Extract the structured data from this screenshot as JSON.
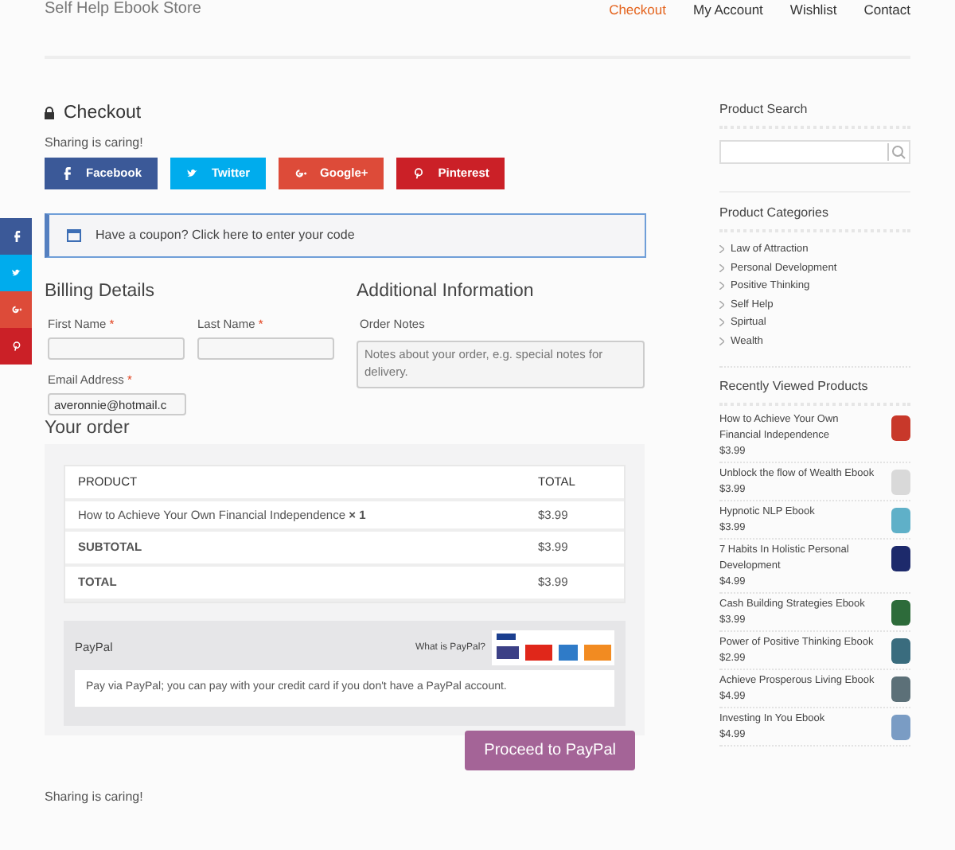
{
  "header": {
    "site_title": "Self Help Ebook Store",
    "nav": [
      {
        "label": "Checkout",
        "selected": true
      },
      {
        "label": "My Account",
        "selected": false
      },
      {
        "label": "Wishlist",
        "selected": false
      },
      {
        "label": "Contact",
        "selected": false
      }
    ]
  },
  "side_share": [
    {
      "kind": "facebook",
      "color": "#3b5998"
    },
    {
      "kind": "twitter",
      "color": "#00aced"
    },
    {
      "kind": "google",
      "color": "#dd4b39"
    },
    {
      "kind": "pinterest",
      "color": "#cb2027"
    }
  ],
  "page_title": "Checkout",
  "sharing_text": "Sharing is caring!",
  "share_buttons": [
    {
      "kind": "facebook",
      "label": "Facebook",
      "color": "#3b5998"
    },
    {
      "kind": "twitter",
      "label": "Twitter",
      "color": "#00aced"
    },
    {
      "kind": "google",
      "label": "Google+",
      "color": "#dd4b39"
    },
    {
      "kind": "pinterest",
      "label": "Pinterest",
      "color": "#cb2027"
    }
  ],
  "coupon": "Have a coupon? Click here to enter your code",
  "billing": {
    "heading": "Billing Details",
    "fields": [
      {
        "label": "First Name",
        "required_mark": "*"
      },
      {
        "label": "Last Name",
        "required_mark": "*"
      },
      {
        "label": "Email Address",
        "required_mark": "*",
        "value": "averonnie@hotmail.c"
      }
    ]
  },
  "additional": {
    "heading": "Additional Information",
    "label": "Order Notes",
    "placeholder": "Notes about your order, e.g. special notes for delivery."
  },
  "order": {
    "heading": "Your order",
    "columns": [
      "PRODUCT",
      "TOTAL"
    ],
    "rows": [
      {
        "product": "How to Achieve Your Own Financial Independence",
        "quantity": "× 1",
        "total": "$3.99"
      }
    ],
    "subtotal": {
      "label": "SUBTOTAL",
      "value": "$3.99"
    },
    "total": {
      "label": "TOTAL",
      "value": "$3.99"
    }
  },
  "payment": {
    "method": "PayPal",
    "what_is": "What is PayPal?",
    "description": "Pay via PayPal; you can pay with your credit card if you don't have a PayPal account.",
    "button": "Proceed to PayPal"
  },
  "footer_sharing": "Sharing is caring!",
  "sidebar": {
    "search_heading": "Product Search",
    "categories_heading": "Product Categories",
    "categories": [
      "Law of Attraction",
      "Personal Development",
      "Positive Thinking",
      "Self Help",
      "Spirtual",
      "Wealth"
    ],
    "recent_heading": "Recently Viewed Products",
    "recent": [
      {
        "title": "How to Achieve Your Own Financial Independence",
        "price": "$3.99"
      },
      {
        "title": "Unblock the flow of Wealth Ebook",
        "price": "$3.99"
      },
      {
        "title": "Hypnotic NLP Ebook",
        "price": "$3.99"
      },
      {
        "title": "7 Habits In Holistic Personal Development",
        "price": "$4.99"
      },
      {
        "title": "Cash Building Strategies Ebook",
        "price": "$3.99"
      },
      {
        "title": "Power of Positive Thinking Ebook",
        "price": "$2.99"
      },
      {
        "title": "Achieve Prosperous Living Ebook",
        "price": "$4.99"
      },
      {
        "title": "Investing In You Ebook",
        "price": "$4.99"
      }
    ]
  }
}
